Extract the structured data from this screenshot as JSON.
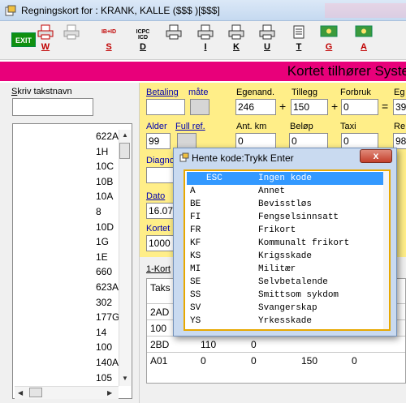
{
  "window": {
    "title": "Regningskort for :  KRANK, KALLE ($$$ )[$$$]"
  },
  "toolbar": {
    "exit_label": "EXIT",
    "buttons": [
      {
        "label": "W",
        "icon": "print-red-icon",
        "red": true
      },
      {
        "label": "",
        "icon": "print-gray-icon",
        "red": false
      },
      {
        "label": "S",
        "icon": "diagnosis-code-icon",
        "caption": "IB+ID",
        "red": true
      },
      {
        "label": "D",
        "icon": "icpc-code-icon",
        "caption": "ICPC ICD",
        "red": false
      },
      {
        "label": "",
        "icon": "printer-icon",
        "red": false
      },
      {
        "label": "I",
        "icon": "printer-icon",
        "red": false
      },
      {
        "label": "K",
        "icon": "printer-icon",
        "red": false
      },
      {
        "label": "U",
        "icon": "printer-icon",
        "red": false
      },
      {
        "label": "T",
        "icon": "document-icon",
        "red": false
      },
      {
        "label": "G",
        "icon": "money-icon",
        "red": true
      },
      {
        "label": "A",
        "icon": "money-icon",
        "red": true
      }
    ]
  },
  "banner": {
    "text": "Kortet tilhører Syste"
  },
  "left": {
    "search_label": "Skriv takstnavn",
    "search_value": "",
    "codes": [
      "622A",
      "1H",
      "10C",
      "10B",
      "10A",
      "8",
      "10D",
      "1G",
      "1E",
      "660",
      "623A",
      "302",
      "177G",
      "14",
      "100",
      "140A",
      "105"
    ]
  },
  "form": {
    "labels": {
      "betaling": "Betaling",
      "maate": "måte",
      "egenand": "Egenand.",
      "tillegg": "Tillegg",
      "forbruk": "Forbruk",
      "eg": "Eg",
      "alder": "Alder",
      "full_ref": "Full ref.",
      "ant_km": "Ant. km",
      "belop": "Beløp",
      "taxi": "Taxi",
      "re": "Re",
      "diagno": "Diagno",
      "dato": "Dato",
      "kortet": "Kortet"
    },
    "values": {
      "betaling": "",
      "egenand": "246",
      "tillegg": "150",
      "forbruk": "0",
      "eg": "39",
      "alder": "99",
      "ant_km": "0",
      "belop": "0",
      "taxi": "0",
      "re": "98",
      "dato": "16.07",
      "kortet": "1000"
    },
    "ops": [
      "+",
      "+",
      "="
    ]
  },
  "table": {
    "section_label": "1-Kort",
    "header": "Taks",
    "rows": [
      [
        "2AD",
        "",
        "",
        "",
        ""
      ],
      [
        "100",
        "",
        "",
        "",
        ""
      ],
      [
        "2BD",
        "110",
        "0",
        "",
        ""
      ],
      [
        "A01",
        "0",
        "0",
        "150",
        "0"
      ]
    ]
  },
  "dialog": {
    "title": "Hente kode:Trykk Enter",
    "close_label": "x",
    "items": [
      {
        "code": "ESC",
        "desc": "Ingen kode"
      },
      {
        "code": "A",
        "desc": "Annet"
      },
      {
        "code": "BE",
        "desc": "Bevisstløs"
      },
      {
        "code": "FI",
        "desc": "Fengselsinnsatt"
      },
      {
        "code": "FR",
        "desc": "Frikort"
      },
      {
        "code": "KF",
        "desc": "Kommunalt frikort"
      },
      {
        "code": "KS",
        "desc": "Krigsskade"
      },
      {
        "code": "MI",
        "desc": "Militær"
      },
      {
        "code": "SE",
        "desc": "Selvbetalende"
      },
      {
        "code": "SS",
        "desc": "Smittsom sykdom"
      },
      {
        "code": "SV",
        "desc": "Svangerskap"
      },
      {
        "code": "YS",
        "desc": "Yrkesskade"
      }
    ]
  },
  "colors": {
    "banner": "#e8007a",
    "form_bg": "#ffee88",
    "selection": "#3399ff",
    "dialog_border": "#e8a800"
  }
}
